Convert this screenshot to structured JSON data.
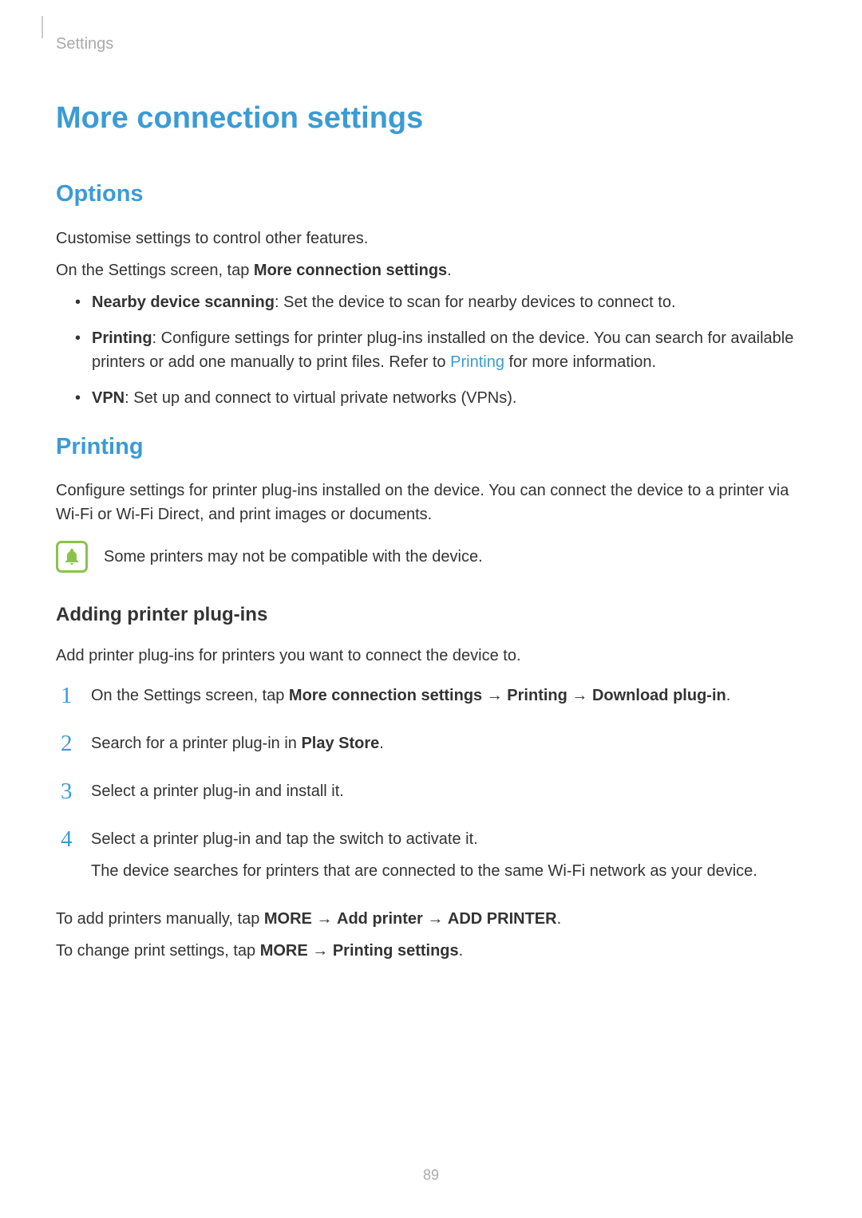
{
  "breadcrumb": "Settings",
  "page_title": "More connection settings",
  "options": {
    "heading": "Options",
    "intro1": "Customise settings to control other features.",
    "intro2_pre": "On the Settings screen, tap ",
    "intro2_bold": "More connection settings",
    "intro2_post": ".",
    "items": [
      {
        "bold": "Nearby device scanning",
        "text": ": Set the device to scan for nearby devices to connect to."
      },
      {
        "bold": "Printing",
        "text_pre": ": Configure settings for printer plug-ins installed on the device. You can search for available printers or add one manually to print files. Refer to ",
        "link": "Printing",
        "text_post": " for more information."
      },
      {
        "bold": "VPN",
        "text": ": Set up and connect to virtual private networks (VPNs)."
      }
    ]
  },
  "printing": {
    "heading": "Printing",
    "intro": "Configure settings for printer plug-ins installed on the device. You can connect the device to a printer via Wi-Fi or Wi-Fi Direct, and print images or documents.",
    "note": "Some printers may not be compatible with the device."
  },
  "adding": {
    "heading": "Adding printer plug-ins",
    "intro": "Add printer plug-ins for printers you want to connect the device to.",
    "steps": [
      {
        "pre": "On the Settings screen, tap ",
        "bold1": "More connection settings",
        "arrow1": " → ",
        "bold2": "Printing",
        "arrow2": " → ",
        "bold3": "Download plug-in",
        "post": "."
      },
      {
        "pre": "Search for a printer plug-in in ",
        "bold1": "Play Store",
        "post": "."
      },
      {
        "pre": "Select a printer plug-in and install it."
      },
      {
        "pre": "Select a printer plug-in and tap the switch to activate it.",
        "sub": "The device searches for printers that are connected to the same Wi-Fi network as your device."
      }
    ],
    "manual_pre": "To add printers manually, tap ",
    "manual_bold1": "MORE",
    "manual_arrow1": " → ",
    "manual_bold2": "Add printer",
    "manual_arrow2": " → ",
    "manual_bold3": "ADD PRINTER",
    "manual_post": ".",
    "change_pre": "To change print settings, tap ",
    "change_bold1": "MORE",
    "change_arrow": " → ",
    "change_bold2": "Printing settings",
    "change_post": "."
  },
  "page_number": "89"
}
